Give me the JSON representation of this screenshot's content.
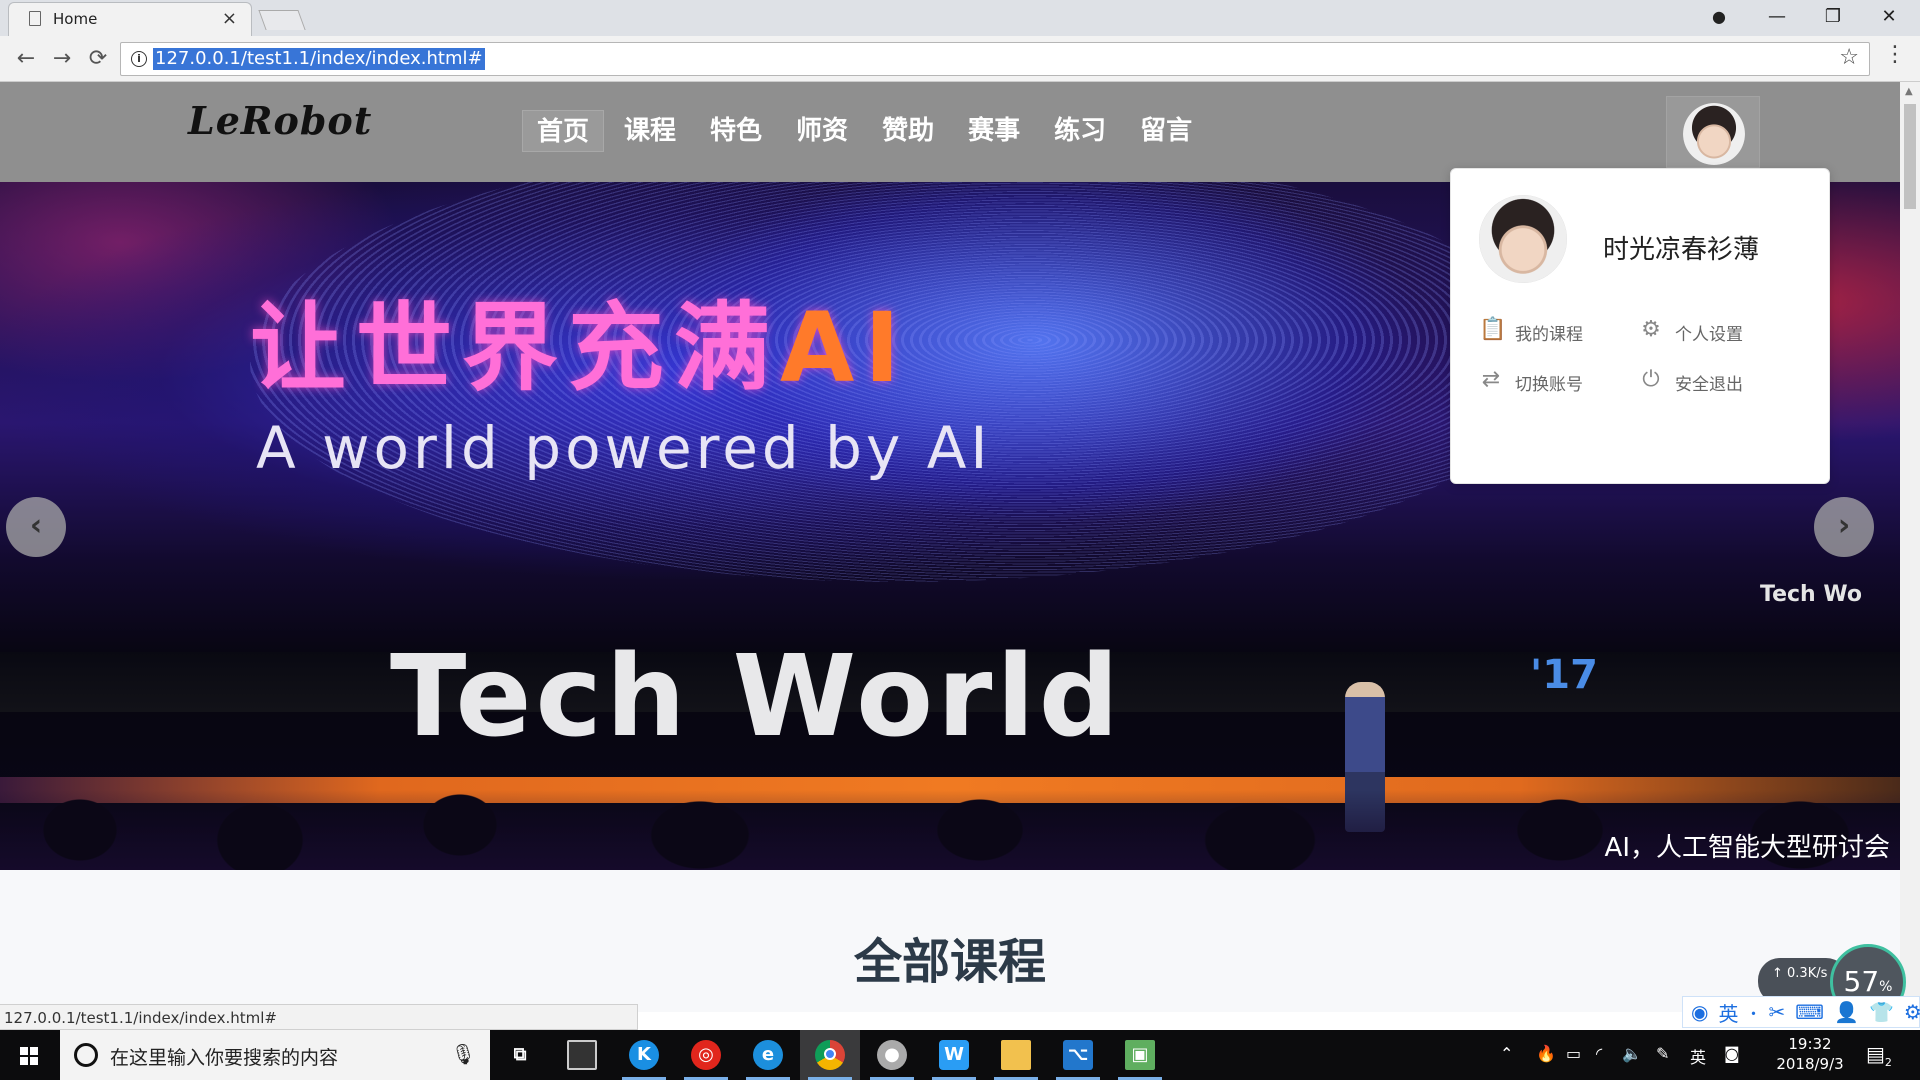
{
  "browser": {
    "tab_title": "Home",
    "tab_close": "×",
    "url": "127.0.0.1/test1.1/index/index.html#",
    "status_url": "127.0.0.1/test1.1/index/index.html#",
    "back": "←",
    "forward": "→",
    "reload": "⟳",
    "info": "i",
    "star": "☆",
    "menu": "⋮",
    "profile": "●",
    "minimize": "—",
    "restore": "❐",
    "close": "✕"
  },
  "site": {
    "logo": "LeRobot",
    "nav": [
      {
        "label": "首页",
        "active": true
      },
      {
        "label": "课程"
      },
      {
        "label": "特色"
      },
      {
        "label": "师资"
      },
      {
        "label": "赞助"
      },
      {
        "label": "赛事"
      },
      {
        "label": "练习"
      },
      {
        "label": "留言"
      }
    ]
  },
  "banner": {
    "cn_headline_main": "让世界充满",
    "cn_headline_ai": "AI",
    "en_headline": "A world powered by AI",
    "stage_text": "Tech World",
    "stage_sup": "'17",
    "side_text": "Tech Wo",
    "caption": "AI，人工智能大型研讨会",
    "prev": "‹",
    "next": "›"
  },
  "section": {
    "title": "全部课程"
  },
  "user_menu": {
    "username": "时光凉春衫薄",
    "items": [
      {
        "label": "我的课程",
        "icon": "📋"
      },
      {
        "label": "个人设置",
        "icon": "⚙"
      },
      {
        "label": "切换账号",
        "icon": "⇄"
      },
      {
        "label": "安全退出",
        "icon": "⏻"
      }
    ]
  },
  "widgets": {
    "net_up": "↑ 0.3K/s",
    "gauge_value": "57",
    "gauge_unit": "%",
    "ime_lang": "英"
  },
  "taskbar": {
    "search_placeholder": "在这里输入你要搜索的内容",
    "mic": "🎙",
    "tray_lang": "英",
    "time": "19:32",
    "date": "2018/9/3",
    "notif_count": "2"
  }
}
